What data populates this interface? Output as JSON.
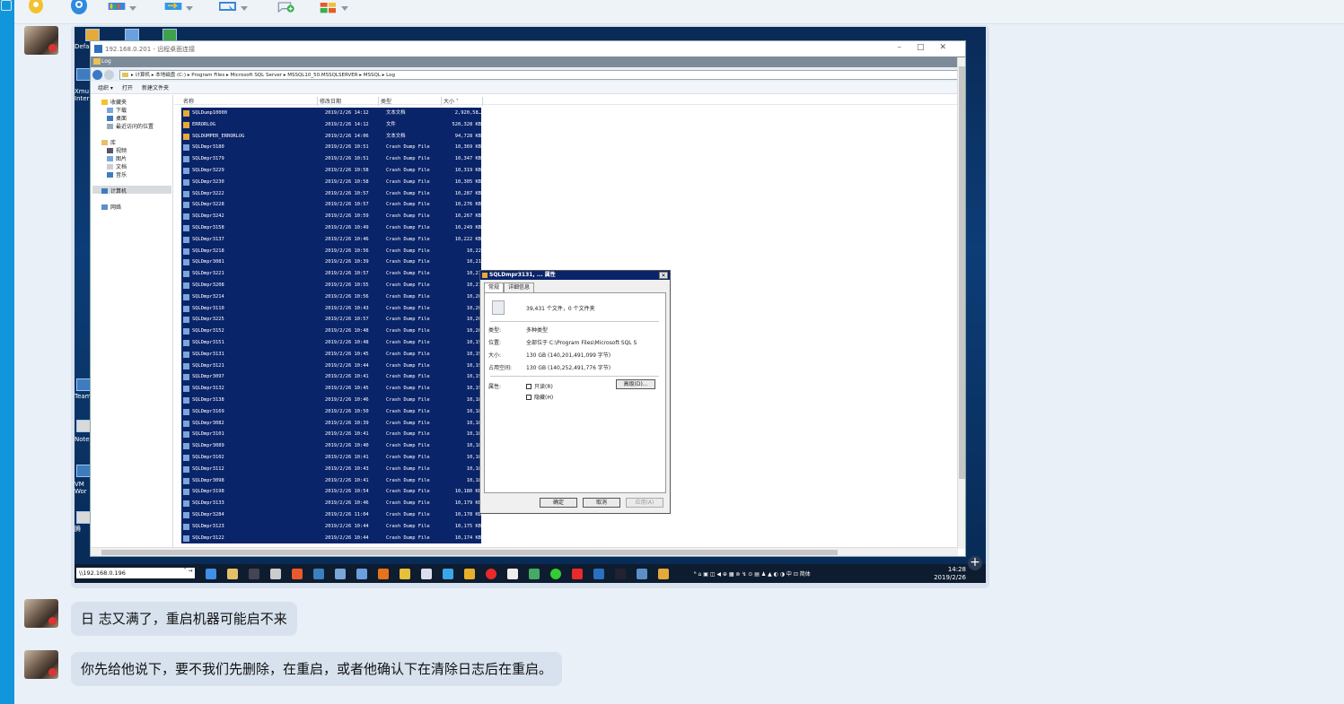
{
  "toolbar": {
    "buttons": [
      {
        "name": "mic-icon",
        "color": "#f2c12e"
      },
      {
        "name": "camera-icon",
        "color": "#2d8ae0"
      },
      {
        "name": "screenshot-icon",
        "color": "#3b86d8"
      },
      {
        "name": "file-transfer-icon",
        "color": "#2e9ae8"
      },
      {
        "name": "remote-desktop-icon",
        "color": "#3b86d8"
      },
      {
        "name": "chat-add-icon",
        "color": "#33b34a"
      },
      {
        "name": "apps-grid-icon",
        "color": "#e85a2a"
      }
    ]
  },
  "remote": {
    "title": "192.168.0.201 - 远程桌面连接",
    "window_title": "Log",
    "breadcrumb": "▸ 计算机 ▸ 本地磁盘 (C:) ▸ Program Files ▸ Microsoft SQL Server ▸ MSSQL10_50.MSSQLSERVER ▸ MSSQL ▸ Log",
    "cmd": {
      "organize": "组织 ▾",
      "open": "打开",
      "new_folder": "新建文件夹"
    },
    "nav": {
      "favorites": "收藏夹",
      "downloads": "下载",
      "desktop": "桌面",
      "recent": "最近访问的位置",
      "libraries": "库",
      "videos": "视频",
      "pictures": "图片",
      "documents": "文档",
      "music": "音乐",
      "computer": "计算机",
      "network": "网络"
    },
    "columns": {
      "name": "名称",
      "date": "修改日期",
      "type": "类型",
      "size": "大小 ˅"
    },
    "files": [
      {
        "name": "SQLDump10000",
        "date": "2019/2/26 14:12",
        "type": "文本文档",
        "size": "2,920,58…",
        "kind": "txt"
      },
      {
        "name": "ERRORLOG",
        "date": "2019/2/26 14:12",
        "type": "文件",
        "size": "520,328 KB",
        "kind": "txt"
      },
      {
        "name": "SQLDUMPER_ERRORLOG",
        "date": "2019/2/26 14:06",
        "type": "文本文档",
        "size": "94,728 KB",
        "kind": "txt"
      },
      {
        "name": "SQLDmpr3180",
        "date": "2019/2/26 10:51",
        "type": "Crash Dump File",
        "size": "10,369 KB",
        "kind": "dmp"
      },
      {
        "name": "SQLDmpr3179",
        "date": "2019/2/26 10:51",
        "type": "Crash Dump File",
        "size": "10,347 KB",
        "kind": "dmp"
      },
      {
        "name": "SQLDmpr3229",
        "date": "2019/2/26 10:58",
        "type": "Crash Dump File",
        "size": "10,319 KB",
        "kind": "dmp"
      },
      {
        "name": "SQLDmpr3230",
        "date": "2019/2/26 10:58",
        "type": "Crash Dump File",
        "size": "10,305 KB",
        "kind": "dmp"
      },
      {
        "name": "SQLDmpr3222",
        "date": "2019/2/26 10:57",
        "type": "Crash Dump File",
        "size": "10,287 KB",
        "kind": "dmp"
      },
      {
        "name": "SQLDmpr3228",
        "date": "2019/2/26 10:57",
        "type": "Crash Dump File",
        "size": "10,276 KB",
        "kind": "dmp"
      },
      {
        "name": "SQLDmpr3242",
        "date": "2019/2/26 10:59",
        "type": "Crash Dump File",
        "size": "10,267 KB",
        "kind": "dmp"
      },
      {
        "name": "SQLDmpr3158",
        "date": "2019/2/26 10:49",
        "type": "Crash Dump File",
        "size": "10,249 KB",
        "kind": "dmp"
      },
      {
        "name": "SQLDmpr3137",
        "date": "2019/2/26 10:46",
        "type": "Crash Dump File",
        "size": "10,222 KB",
        "kind": "dmp"
      },
      {
        "name": "SQLDmpr3218",
        "date": "2019/2/26 10:56",
        "type": "Crash Dump File",
        "size": "10,22",
        "kind": "dmp"
      },
      {
        "name": "SQLDmpr3081",
        "date": "2019/2/26 10:39",
        "type": "Crash Dump File",
        "size": "10,21",
        "kind": "dmp"
      },
      {
        "name": "SQLDmpr3221",
        "date": "2019/2/26 10:57",
        "type": "Crash Dump File",
        "size": "10,21",
        "kind": "dmp"
      },
      {
        "name": "SQLDmpr3208",
        "date": "2019/2/26 10:55",
        "type": "Crash Dump File",
        "size": "10,21",
        "kind": "dmp"
      },
      {
        "name": "SQLDmpr3214",
        "date": "2019/2/26 10:56",
        "type": "Crash Dump File",
        "size": "10,20",
        "kind": "dmp"
      },
      {
        "name": "SQLDmpr3110",
        "date": "2019/2/26 10:43",
        "type": "Crash Dump File",
        "size": "10,20",
        "kind": "dmp"
      },
      {
        "name": "SQLDmpr3225",
        "date": "2019/2/26 10:57",
        "type": "Crash Dump File",
        "size": "10,20",
        "kind": "dmp"
      },
      {
        "name": "SQLDmpr3152",
        "date": "2019/2/26 10:48",
        "type": "Crash Dump File",
        "size": "10,20",
        "kind": "dmp"
      },
      {
        "name": "SQLDmpr3151",
        "date": "2019/2/26 10:48",
        "type": "Crash Dump File",
        "size": "10,19",
        "kind": "dmp"
      },
      {
        "name": "SQLDmpr3131",
        "date": "2019/2/26 10:45",
        "type": "Crash Dump File",
        "size": "10,19",
        "kind": "dmp"
      },
      {
        "name": "SQLDmpr3121",
        "date": "2019/2/26 10:44",
        "type": "Crash Dump File",
        "size": "10,19",
        "kind": "dmp"
      },
      {
        "name": "SQLDmpr3097",
        "date": "2019/2/26 10:41",
        "type": "Crash Dump File",
        "size": "10,19",
        "kind": "dmp"
      },
      {
        "name": "SQLDmpr3132",
        "date": "2019/2/26 10:45",
        "type": "Crash Dump File",
        "size": "10,19",
        "kind": "dmp"
      },
      {
        "name": "SQLDmpr3138",
        "date": "2019/2/26 10:46",
        "type": "Crash Dump File",
        "size": "10,18",
        "kind": "dmp"
      },
      {
        "name": "SQLDmpr3169",
        "date": "2019/2/26 10:50",
        "type": "Crash Dump File",
        "size": "10,18",
        "kind": "dmp"
      },
      {
        "name": "SQLDmpr3082",
        "date": "2019/2/26 10:39",
        "type": "Crash Dump File",
        "size": "10,18",
        "kind": "dmp"
      },
      {
        "name": "SQLDmpr3101",
        "date": "2019/2/26 10:41",
        "type": "Crash Dump File",
        "size": "10,18",
        "kind": "dmp"
      },
      {
        "name": "SQLDmpr3089",
        "date": "2019/2/26 10:40",
        "type": "Crash Dump File",
        "size": "10,18",
        "kind": "dmp"
      },
      {
        "name": "SQLDmpr3102",
        "date": "2019/2/26 10:41",
        "type": "Crash Dump File",
        "size": "10,18",
        "kind": "dmp"
      },
      {
        "name": "SQLDmpr3112",
        "date": "2019/2/26 10:43",
        "type": "Crash Dump File",
        "size": "10,18",
        "kind": "dmp"
      },
      {
        "name": "SQLDmpr3098",
        "date": "2019/2/26 10:41",
        "type": "Crash Dump File",
        "size": "10,18",
        "kind": "dmp"
      },
      {
        "name": "SQLDmpr3198",
        "date": "2019/2/26 10:54",
        "type": "Crash Dump File",
        "size": "10,180 KB",
        "kind": "dmp"
      },
      {
        "name": "SQLDmpr3133",
        "date": "2019/2/26 10:46",
        "type": "Crash Dump File",
        "size": "10,179 KB",
        "kind": "dmp"
      },
      {
        "name": "SQLDmpr3284",
        "date": "2019/2/26 11:04",
        "type": "Crash Dump File",
        "size": "10,178 KB",
        "kind": "dmp"
      },
      {
        "name": "SQLDmpr3123",
        "date": "2019/2/26 10:44",
        "type": "Crash Dump File",
        "size": "10,175 KB",
        "kind": "dmp"
      },
      {
        "name": "SQLDmpr3122",
        "date": "2019/2/26 10:44",
        "type": "Crash Dump File",
        "size": "10,174 KB",
        "kind": "dmp"
      }
    ],
    "dialog": {
      "title": "SQLDmpr3131, ... 属性",
      "tab_general": "常规",
      "tab_details": "详细信息",
      "summary": "39,431 个文件，0 个文件夹",
      "type_label": "类型:",
      "type_value": "多种类型",
      "location_label": "位置:",
      "location_value": "全部位于 C:\\Program Files\\Microsoft SQL S",
      "size_label": "大小:",
      "size_value": "130 GB (140,201,491,099 字节)",
      "disk_label": "占用空间:",
      "disk_value": "130 GB (140,252,491,776 字节)",
      "attr_label": "属性:",
      "readonly": "只读(R)",
      "hidden": "隐藏(H)",
      "advanced": "高级(D)...",
      "ok": "确定",
      "cancel": "取消",
      "apply": "应用(A)"
    },
    "taskbar": {
      "address": "\\\\192.168.0.196",
      "go": "˅ →",
      "tray": "ᴿ  ⌂ ▣ ◫ ◀ ⊕ ▦ ⊚ ↯ ⊙ ▤ ♟ ▲ ◐ ◑ 中 ⊡  简体",
      "time": "14:28",
      "date": "2019/2/26"
    },
    "desk_labels": {
      "a": "Defa",
      "b": "Xmu",
      "c": "Inter",
      "d": "Team",
      "e": "Note",
      "f": "VM",
      "g": "Wor",
      "h": "腾"
    }
  },
  "messages": [
    {
      "text": "日 志又满了，重启机器可能启不来"
    },
    {
      "text": "你先给他说下，要不我们先删除，在重启，或者他确认下在清除日志后在重启。"
    }
  ]
}
